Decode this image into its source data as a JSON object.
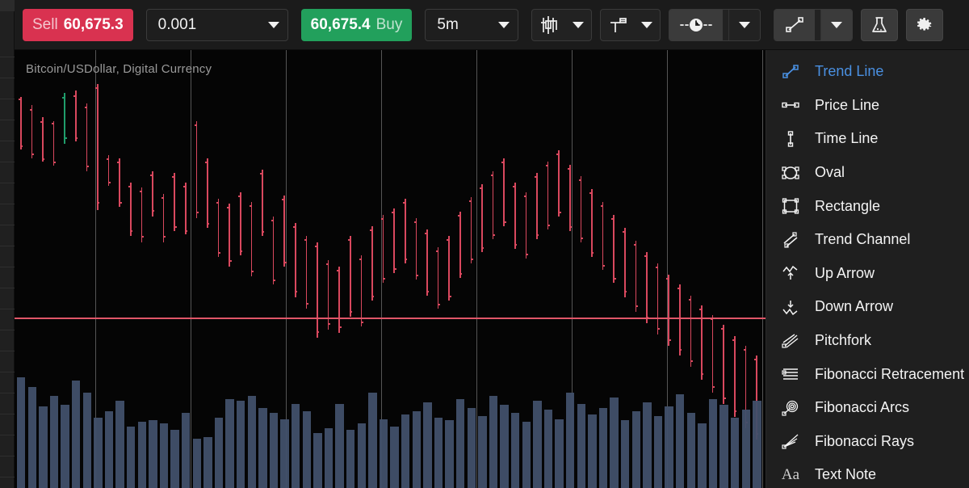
{
  "toolbar": {
    "sell": {
      "side_label": "Sell",
      "price": "60,675.3"
    },
    "buy": {
      "side_label": "Buy",
      "price": "60,675.4"
    },
    "quantity": {
      "value": "0.001"
    },
    "timeframe": {
      "value": "5m"
    },
    "icons": {
      "chart_type": "candlestick-type-icon",
      "scale": "scale-settings-icon",
      "clock": "session-clock-icon",
      "trend_tool": "trend-line-tool-icon",
      "flask": "indicators-flask-icon",
      "gear": "chart-settings-gear-icon"
    }
  },
  "chart": {
    "title": "Bitcoin/USDollar, Digital Currency",
    "symbol": "Bitcoin/USDollar",
    "instrument_type": "Digital Currency",
    "last_price_line": "60,675.3",
    "colors": {
      "up": "#1f9d6b",
      "down": "#d9485e",
      "volume": "#41506a",
      "price_line": "#e05668",
      "background": "#050505",
      "sell_button": "#d93250",
      "buy_button": "#22a05c",
      "accent": "#4a90e2"
    }
  },
  "drawing_menu": {
    "selected": "Trend Line",
    "items": [
      {
        "label": "Trend Line",
        "icon": "trend-line-icon"
      },
      {
        "label": "Price Line",
        "icon": "price-line-icon"
      },
      {
        "label": "Time Line",
        "icon": "time-line-icon"
      },
      {
        "label": "Oval",
        "icon": "oval-icon"
      },
      {
        "label": "Rectangle",
        "icon": "rectangle-icon"
      },
      {
        "label": "Trend Channel",
        "icon": "trend-channel-icon"
      },
      {
        "label": "Up Arrow",
        "icon": "up-arrow-icon"
      },
      {
        "label": "Down Arrow",
        "icon": "down-arrow-icon"
      },
      {
        "label": "Pitchfork",
        "icon": "pitchfork-icon"
      },
      {
        "label": "Fibonacci Retracement",
        "icon": "fibonacci-retracement-icon"
      },
      {
        "label": "Fibonacci Arcs",
        "icon": "fibonacci-arcs-icon"
      },
      {
        "label": "Fibonacci Rays",
        "icon": "fibonacci-rays-icon"
      },
      {
        "label": "Text Note",
        "icon": "text-note-icon"
      }
    ]
  },
  "chart_data": {
    "type": "ohlc",
    "title": "Bitcoin/USDollar, Digital Currency",
    "xlabel": "",
    "ylabel": "",
    "grid": true,
    "price_line_y": 393,
    "bars": [
      [
        120,
        185,
        122,
        180
      ],
      [
        130,
        196,
        135,
        190
      ],
      [
        145,
        200,
        150,
        196
      ],
      [
        150,
        205,
        152,
        200
      ],
      [
        115,
        178,
        170,
        120
      ],
      [
        112,
        175,
        118,
        170
      ],
      [
        128,
        212,
        132,
        205
      ],
      [
        104,
        260,
        108,
        250
      ],
      [
        192,
        230,
        196,
        225
      ],
      [
        196,
        256,
        200,
        250
      ],
      [
        226,
        292,
        230,
        285
      ],
      [
        232,
        300,
        236,
        292
      ],
      [
        212,
        268,
        216,
        260
      ],
      [
        240,
        300,
        244,
        292
      ],
      [
        214,
        286,
        218,
        280
      ],
      [
        226,
        290,
        230,
        285
      ],
      [
        150,
        270,
        154,
        262
      ],
      [
        196,
        282,
        200,
        276
      ],
      [
        246,
        318,
        250,
        312
      ],
      [
        252,
        330,
        256,
        322
      ],
      [
        238,
        316,
        242,
        310
      ],
      [
        250,
        342,
        254,
        335
      ],
      [
        210,
        292,
        214,
        286
      ],
      [
        268,
        352,
        272,
        346
      ],
      [
        242,
        330,
        246,
        324
      ],
      [
        276,
        368,
        280,
        360
      ],
      [
        292,
        382,
        296,
        375
      ],
      [
        300,
        418,
        304,
        410
      ],
      [
        322,
        408,
        326,
        400
      ],
      [
        330,
        412,
        334,
        404
      ],
      [
        292,
        392,
        296,
        385
      ],
      [
        316,
        404,
        320,
        398
      ],
      [
        280,
        372,
        284,
        366
      ],
      [
        266,
        350,
        270,
        344
      ],
      [
        258,
        338,
        262,
        332
      ],
      [
        246,
        326,
        250,
        320
      ],
      [
        270,
        346,
        274,
        340
      ],
      [
        284,
        366,
        288,
        360
      ],
      [
        306,
        382,
        310,
        376
      ],
      [
        292,
        372,
        296,
        366
      ],
      [
        262,
        344,
        266,
        338
      ],
      [
        244,
        326,
        248,
        320
      ],
      [
        228,
        312,
        232,
        306
      ],
      [
        212,
        296,
        216,
        290
      ],
      [
        196,
        280,
        200,
        274
      ],
      [
        226,
        308,
        230,
        302
      ],
      [
        238,
        320,
        242,
        314
      ],
      [
        214,
        296,
        218,
        290
      ],
      [
        200,
        284,
        204,
        278
      ],
      [
        186,
        268,
        190,
        262
      ],
      [
        204,
        286,
        208,
        280
      ],
      [
        218,
        300,
        222,
        294
      ],
      [
        234,
        318,
        238,
        312
      ],
      [
        250,
        334,
        254,
        328
      ],
      [
        266,
        350,
        270,
        344
      ],
      [
        282,
        368,
        286,
        360
      ],
      [
        298,
        386,
        302,
        378
      ],
      [
        312,
        400,
        316,
        392
      ],
      [
        326,
        414,
        330,
        406
      ],
      [
        340,
        428,
        344,
        420
      ],
      [
        352,
        440,
        356,
        432
      ],
      [
        366,
        454,
        370,
        446
      ],
      [
        378,
        470,
        382,
        462
      ],
      [
        390,
        486,
        394,
        478
      ],
      [
        402,
        500,
        406,
        492
      ],
      [
        416,
        516,
        420,
        508
      ],
      [
        428,
        530,
        432,
        522
      ],
      [
        440,
        544,
        444,
        536
      ]
    ],
    "volumes": [
      0.72,
      0.66,
      0.53,
      0.6,
      0.54,
      0.7,
      0.62,
      0.46,
      0.5,
      0.57,
      0.4,
      0.43,
      0.44,
      0.42,
      0.38,
      0.49,
      0.32,
      0.33,
      0.46,
      0.58,
      0.57,
      0.6,
      0.52,
      0.49,
      0.45,
      0.55,
      0.5,
      0.36,
      0.39,
      0.55,
      0.38,
      0.42,
      0.62,
      0.45,
      0.4,
      0.48,
      0.5,
      0.56,
      0.46,
      0.44,
      0.58,
      0.52,
      0.47,
      0.6,
      0.54,
      0.49,
      0.43,
      0.57,
      0.51,
      0.45,
      0.62,
      0.55,
      0.48,
      0.52,
      0.59,
      0.44,
      0.5,
      0.56,
      0.47,
      0.53,
      0.61,
      0.49,
      0.42,
      0.58,
      0.54,
      0.46,
      0.51,
      0.57
    ]
  }
}
